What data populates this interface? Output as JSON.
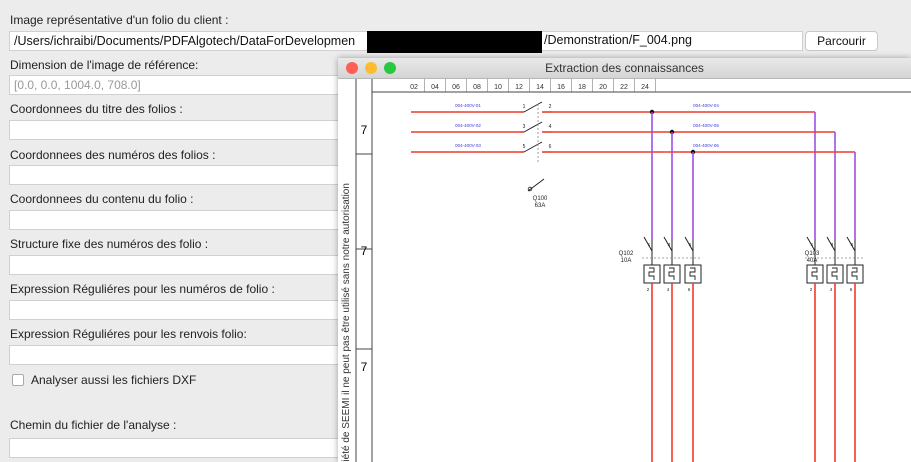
{
  "form": {
    "image_label": "Image représentative d'un folio du client :",
    "path_visible": "/Users/ichraibi/Documents/PDFAlgotech/DataForDevelopmen",
    "path_end": "/Demonstration/F_004.png",
    "browse_button": "Parcourir",
    "dimension_label": "Dimension de l'image de référence:",
    "dimension_value": "[0.0, 0.0, 1004.0, 708.0]",
    "title_coords_label": "Coordonnees du titre des folios :",
    "number_coords_label": "Coordonnees des numéros des folios :",
    "content_coords_label": "Coordonnees du contenu du folio :",
    "structure_label": "Structure fixe des numéros des folio :",
    "regex_numbers_label": "Expression Réguliéres pour les numéros de folio :",
    "regex_refs_label": "Expression Réguliéres pour les renvois folio:",
    "dxf_label": "Analyser aussi les fichiers DXF",
    "analysis_path_label": "Chemin du fichier de l'analyse :"
  },
  "window": {
    "title": "Extraction des connaissances",
    "traffic_lights": [
      "#ff5f57",
      "#febc2e",
      "#28c840"
    ]
  },
  "schematic": {
    "column_labels": [
      "02",
      "04",
      "06",
      "08",
      "10",
      "12",
      "14",
      "16",
      "18",
      "20",
      "22",
      "24"
    ],
    "row_labels": [
      "A",
      "B",
      "C"
    ],
    "vertical_text": "riété de SEEMI il ne peut pas être utilisé sans notre autorisation",
    "left_wire_labels": [
      "004-400V-01",
      "004-400V-02",
      "004-400V-03"
    ],
    "right_wire_labels": [
      "004-400V-04",
      "004-400V-05",
      "004-400V-06"
    ],
    "switch_terminals": [
      "1",
      "2",
      "3",
      "4",
      "5",
      "6"
    ],
    "switch_name": "Q100",
    "switch_rating": "63A",
    "breaker1_name": "Q102",
    "breaker1_rating": "10A",
    "breaker2_name": "Q103",
    "breaker2_rating": "40A",
    "breaker_top_terminals": [
      "1",
      "3",
      "5"
    ],
    "breaker_bottom_terminals": [
      "2",
      "4",
      "6"
    ],
    "colors": {
      "power": "#ef3b2c",
      "control": "#a04ee0",
      "label": "#3a3ae0"
    }
  }
}
